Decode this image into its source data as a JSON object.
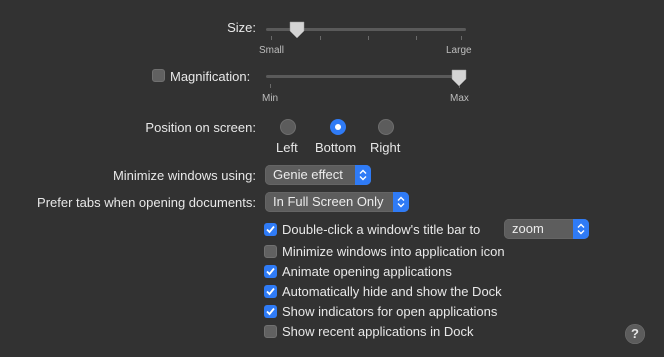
{
  "size": {
    "label": "Size:",
    "min_label": "Small",
    "max_label": "Large",
    "value_fraction": 0.16
  },
  "magnification": {
    "label": "Magnification:",
    "checked": false,
    "min_label": "Min",
    "max_label": "Max",
    "value_fraction": 1.0
  },
  "position": {
    "label": "Position on screen:",
    "options": [
      "Left",
      "Bottom",
      "Right"
    ],
    "selected": "Bottom"
  },
  "minimize": {
    "label": "Minimize windows using:",
    "value": "Genie effect"
  },
  "prefer_tabs": {
    "label": "Prefer tabs when opening documents:",
    "value": "In Full Screen Only"
  },
  "double_click": {
    "label": "Double-click a window's title bar to",
    "checked": true,
    "value": "zoom"
  },
  "checkboxes": [
    {
      "label": "Minimize windows into application icon",
      "checked": false
    },
    {
      "label": "Animate opening applications",
      "checked": true
    },
    {
      "label": "Automatically hide and show the Dock",
      "checked": true
    },
    {
      "label": "Show indicators for open applications",
      "checked": true
    },
    {
      "label": "Show recent applications in Dock",
      "checked": false
    }
  ],
  "help": {
    "label": "?"
  },
  "colors": {
    "accent": "#2f7bf6",
    "background": "#323232"
  }
}
